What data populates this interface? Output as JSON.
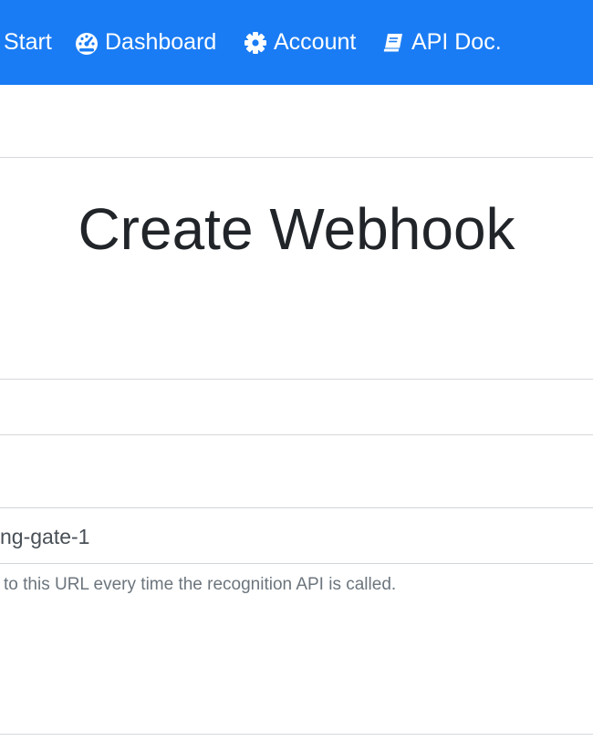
{
  "navbar": {
    "background": "#1a7cf4",
    "items": [
      {
        "label": "Start",
        "icon": "none"
      },
      {
        "label": "Dashboard",
        "icon": "tachometer-icon"
      },
      {
        "label": "Account",
        "icon": "gear-icon"
      },
      {
        "label": "API Doc.",
        "icon": "book-icon"
      }
    ]
  },
  "page": {
    "title": "Create Webhook"
  },
  "form": {
    "url_value": "ng-gate-1",
    "help_text": "to this URL every time the recognition API is called."
  }
}
